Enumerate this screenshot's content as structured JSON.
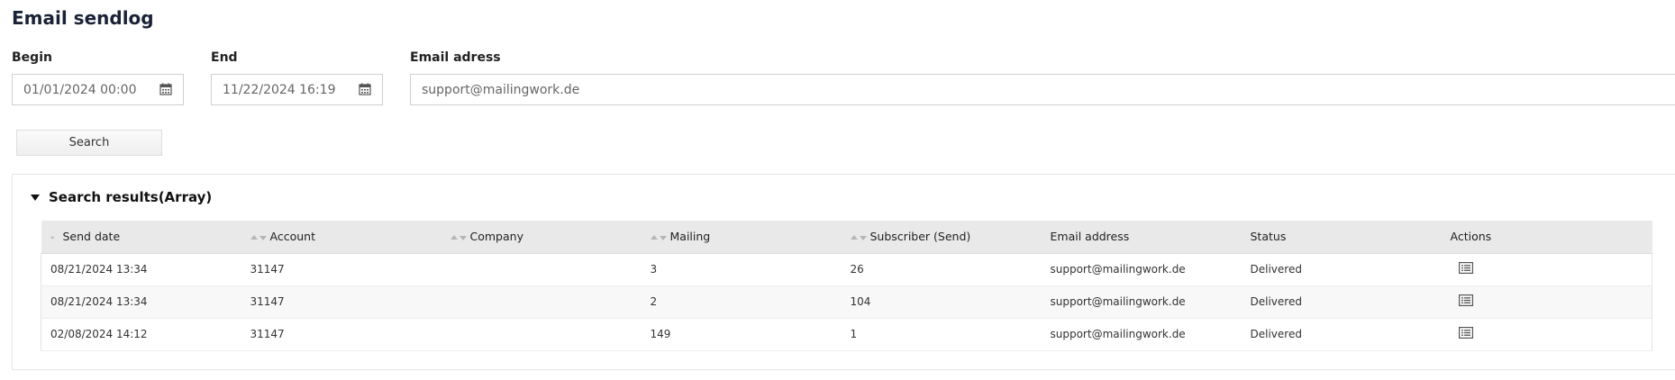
{
  "page": {
    "title": "Email sendlog"
  },
  "filters": {
    "begin_label": "Begin",
    "begin_value": "01/01/2024 00:00",
    "end_label": "End",
    "end_value": "11/22/2024 16:19",
    "email_label": "Email adress",
    "email_value": "support@mailingwork.de",
    "calendar_icon": "calendar-icon"
  },
  "search": {
    "button_label": "Search"
  },
  "results": {
    "title": "Search results(Array)",
    "toggle_icon": "caret-down-icon",
    "columns": {
      "send_date": "Send date",
      "account": "Account",
      "company": "Company",
      "mailing": "Mailing",
      "subscriber": "Subscriber (Send)",
      "email": "Email address",
      "status": "Status",
      "actions": "Actions"
    },
    "rows": [
      {
        "send_date": "08/21/2024 13:34",
        "account": "31147",
        "company": "",
        "mailing": "3",
        "subscriber": "26",
        "email": "support@mailingwork.de",
        "status": "Delivered"
      },
      {
        "send_date": "08/21/2024 13:34",
        "account": "31147",
        "company": "",
        "mailing": "2",
        "subscriber": "104",
        "email": "support@mailingwork.de",
        "status": "Delivered"
      },
      {
        "send_date": "02/08/2024 14:12",
        "account": "31147",
        "company": "",
        "mailing": "149",
        "subscriber": "1",
        "email": "support@mailingwork.de",
        "status": "Delivered"
      }
    ],
    "action_icon": "details-list-icon"
  },
  "colors": {
    "title": "#1a2236",
    "header_bg": "#e9e9e9",
    "border": "#cfcfcf"
  }
}
